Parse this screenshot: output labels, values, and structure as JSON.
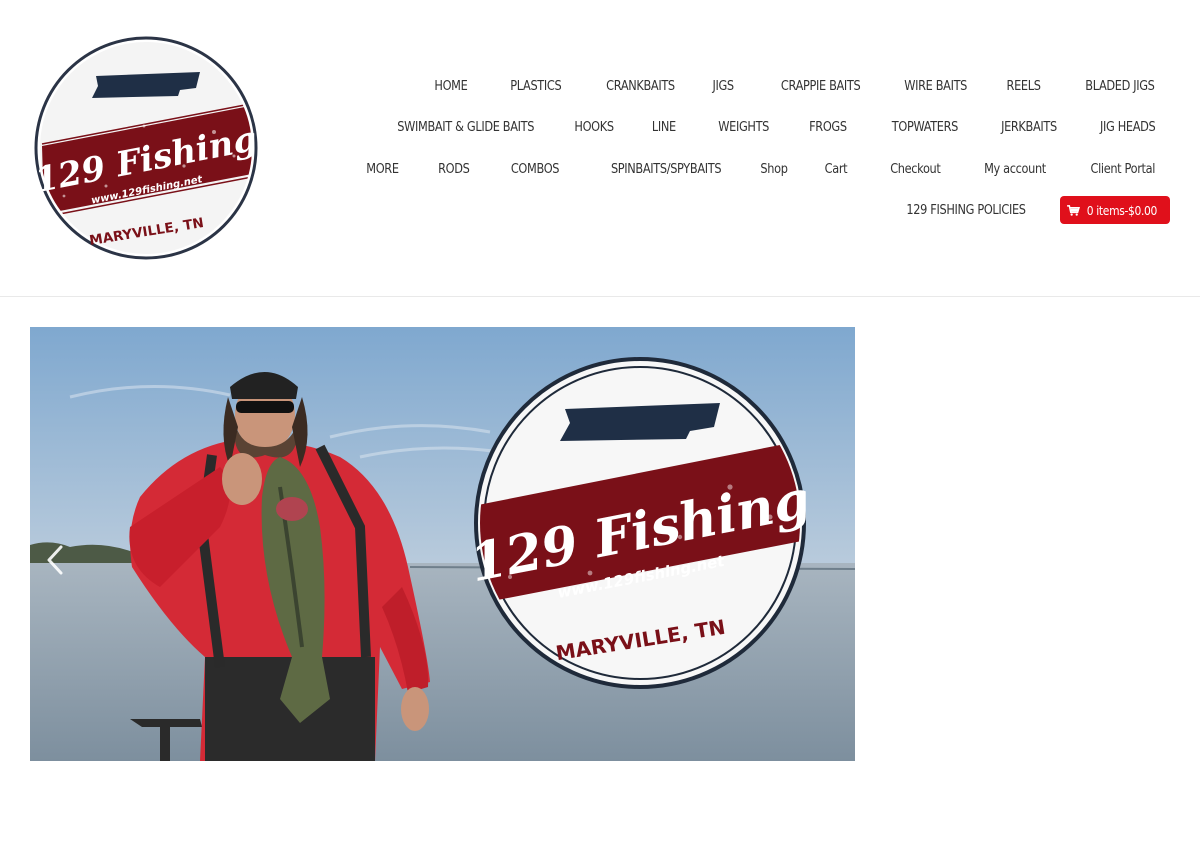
{
  "brand": {
    "logo_top_text": "129 Fishing",
    "logo_url_text": "www.129fishing.net",
    "logo_bottom_text": "MARYVILLE, TN"
  },
  "nav": {
    "row1": [
      "HOME",
      "PLASTICS",
      "CRANKBAITS",
      "JIGS",
      "CRAPPIE BAITS",
      "WIRE BAITS",
      "REELS",
      "BLADED JIGS"
    ],
    "row2": [
      "SWIMBAIT & GLIDE BAITS",
      "HOOKS",
      "LINE",
      "WEIGHTS",
      "FROGS",
      "TOPWATERS",
      "JERKBAITS",
      "JIG HEADS"
    ],
    "row3": [
      "MORE",
      "RODS",
      "COMBOS",
      "SPINBAITS/SPYBAITS",
      "Shop",
      "Cart",
      "Checkout",
      "My account",
      "Client Portal"
    ],
    "row4": [
      "129 FISHING POLICIES"
    ]
  },
  "cart": {
    "label": "0 items-$0.00",
    "icon": "cart-icon",
    "color": "#e0101b"
  },
  "slider": {
    "prev_icon": "chevron-left-icon"
  },
  "colors": {
    "maroon": "#7a1018",
    "navy": "#1f2f46",
    "cart_red": "#e0101b"
  }
}
